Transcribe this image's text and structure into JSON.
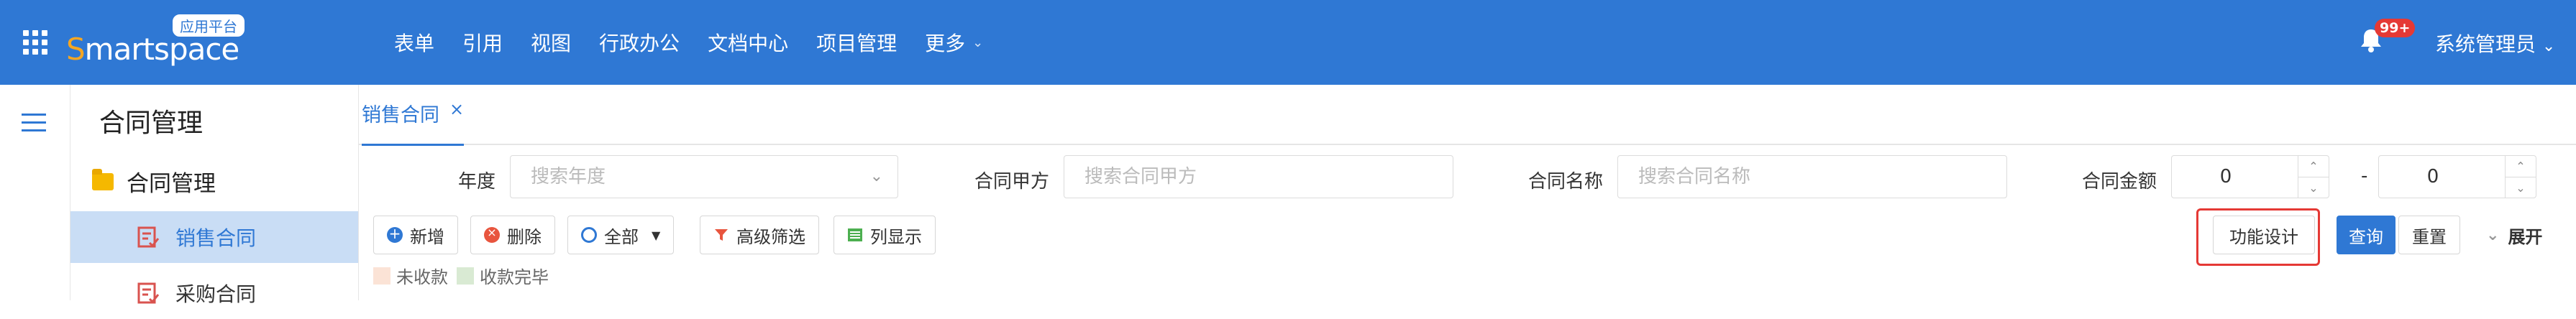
{
  "header": {
    "logo_text": "Smartspace",
    "logo_badge": "应用平台",
    "nav": [
      "表单",
      "引用",
      "视图",
      "行政办公",
      "文档中心",
      "项目管理",
      "更多"
    ],
    "notification_count": "99+",
    "user_name": "系统管理员"
  },
  "sidebar": {
    "title": "合同管理",
    "group": "合同管理",
    "items": [
      "销售合同",
      "采购合同"
    ]
  },
  "tabs": [
    {
      "label": "销售合同",
      "close": "×"
    }
  ],
  "filters": {
    "year_label": "年度",
    "year_placeholder": "搜索年度",
    "party_label": "合同甲方",
    "party_placeholder": "搜索合同甲方",
    "name_label": "合同名称",
    "name_placeholder": "搜索合同名称",
    "amount_label": "合同金额",
    "amount_min": "0",
    "amount_max": "0",
    "amount_sep": "-"
  },
  "toolbar": {
    "add": "新增",
    "delete": "删除",
    "all": "全部",
    "advanced": "高级筛选",
    "columns": "列显示",
    "design": "功能设计",
    "query": "查询",
    "reset": "重置",
    "expand": "展开"
  },
  "legend": [
    {
      "label": "未收款",
      "color": "#fbe3d6"
    },
    {
      "label": "收款完毕",
      "color": "#d9ead3"
    }
  ],
  "colors": {
    "primary": "#2f78d4",
    "highlight": "#e53935"
  }
}
